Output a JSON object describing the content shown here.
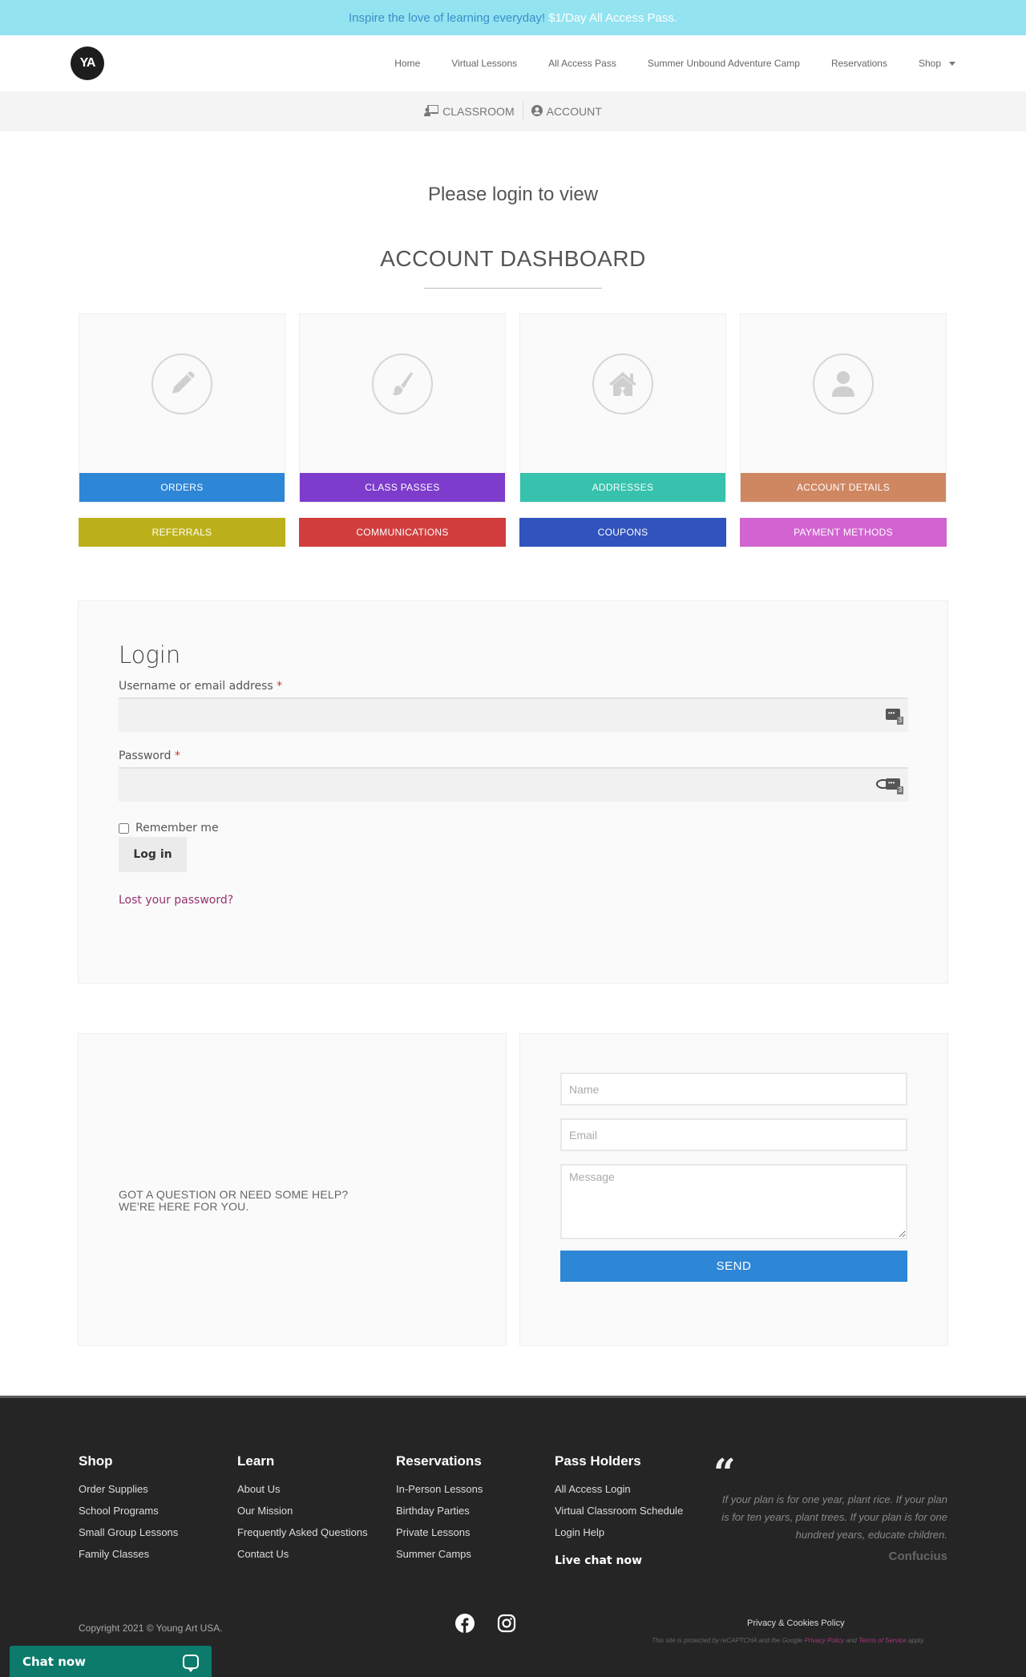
{
  "banner": {
    "lead": "Inspire the love of learning everyday!",
    "promo": "$1/Day All Access Pass."
  },
  "header": {
    "logo_text": "YA",
    "nav": [
      {
        "label": "Home"
      },
      {
        "label": "Virtual Lessons"
      },
      {
        "label": "All Access Pass"
      },
      {
        "label": "Summer Unbound Adventure Camp"
      },
      {
        "label": "Reservations"
      },
      {
        "label": "Shop"
      }
    ]
  },
  "subnav": {
    "classroom": "CLASSROOM",
    "account": "ACCOUNT"
  },
  "main": {
    "please_login": "Please login to view",
    "dashboard_title": "ACCOUNT DASHBOARD"
  },
  "dashboard": {
    "tiles": [
      {
        "label": "ORDERS",
        "icon": "pencil-icon",
        "color": "#2e86d6"
      },
      {
        "label": "CLASS PASSES",
        "icon": "paintbrush-icon",
        "color": "#7d3ccc"
      },
      {
        "label": "ADDRESSES",
        "icon": "house-icon",
        "color": "#36c2ad"
      },
      {
        "label": "ACCOUNT DETAILS",
        "icon": "user-icon",
        "color": "#cf8762"
      }
    ],
    "buttons": [
      {
        "label": "REFERRALS",
        "color": "#bcb11a"
      },
      {
        "label": "COMMUNICATIONS",
        "color": "#d13d3d"
      },
      {
        "label": "COUPONS",
        "color": "#3053bd"
      },
      {
        "label": "PAYMENT METHODS",
        "color": "#d164d0"
      }
    ]
  },
  "login": {
    "title": "Login",
    "username_label": "Username or email address",
    "password_label": "Password",
    "required_mark": "*",
    "username_value": "",
    "password_value": "",
    "remember_label": "Remember me",
    "remember_checked": false,
    "submit_label": "Log in",
    "lost_password": "Lost your password?"
  },
  "help": {
    "question_line1": "GOT A QUESTION OR NEED SOME HELP?",
    "question_line2": "WE'RE HERE FOR YOU.",
    "name_placeholder": "Name",
    "email_placeholder": "Email",
    "message_placeholder": "Message",
    "send_label": "SEND"
  },
  "footer": {
    "columns": [
      {
        "title": "Shop",
        "links": [
          "Order Supplies",
          "School Programs",
          "Small Group Lessons",
          "Family Classes"
        ]
      },
      {
        "title": "Learn",
        "links": [
          "About Us",
          "Our Mission",
          "Frequently Asked Questions",
          "Contact Us"
        ]
      },
      {
        "title": "Reservations",
        "links": [
          "In-Person Lessons",
          "Birthday Parties",
          "Private Lessons",
          "Summer Camps"
        ]
      },
      {
        "title": "Pass Holders",
        "links": [
          "All Access Login",
          "Virtual Classroom Schedule",
          "Login Help"
        ],
        "extra": "Live chat now"
      }
    ],
    "quote_mark": "“",
    "quote": "If your plan is for one year, plant rice. If your plan is for ten years, plant trees. If your plan is for one hundred years, educate children.",
    "quote_author": "Confucius",
    "copyright": "Copyright 2021 © Young Art USA.",
    "policy": "Privacy & Cookies Policy",
    "recaptcha_pre": "This site is protected by reCAPTCHA and the Google",
    "recaptcha_privacy": "Privacy Policy",
    "recaptcha_and": "and",
    "recaptcha_terms": "Terms of Service",
    "recaptcha_post": "apply."
  },
  "chat_widget": {
    "label": "Chat now"
  }
}
